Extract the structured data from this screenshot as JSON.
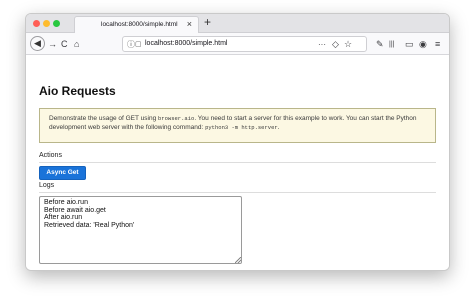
{
  "browser": {
    "tab_title": "localhost:8000/simple.html",
    "url": "localhost:8000/simple.html",
    "traffic_lights": {
      "close": "#ff5f57",
      "minimize": "#febc2e",
      "zoom": "#28c840"
    },
    "icons": {
      "back": "◀",
      "forward": "→",
      "reload": "C",
      "home": "⌂",
      "new_tab": "+",
      "close_tab": "×",
      "site_info": "ⓘ",
      "page_actions": "···",
      "pocket": "◇",
      "bookmark": "☆",
      "tools": "✎",
      "library": "|||",
      "sidebar": "▭",
      "account": "◉",
      "menu": "≡"
    }
  },
  "page": {
    "title": "Aio Requests",
    "alert": {
      "text_1": "Demonstrate the usage of GET using ",
      "code_1": "browser.aio",
      "text_2": ". You need to start a server for this example to work. You can start the Python development web server with the following command: ",
      "code_2": "python3 -m http.server",
      "text_3": ".",
      "bg_color": "#fcf8e3"
    },
    "actions_label": "Actions",
    "button_label": "Async Get",
    "button_color": "#1a73d9",
    "logs_label": "Logs",
    "logs_text": "Before aio.run\nBefore await aio.get\nAfter aio.run\nRetrieved data: 'Real Python'"
  }
}
